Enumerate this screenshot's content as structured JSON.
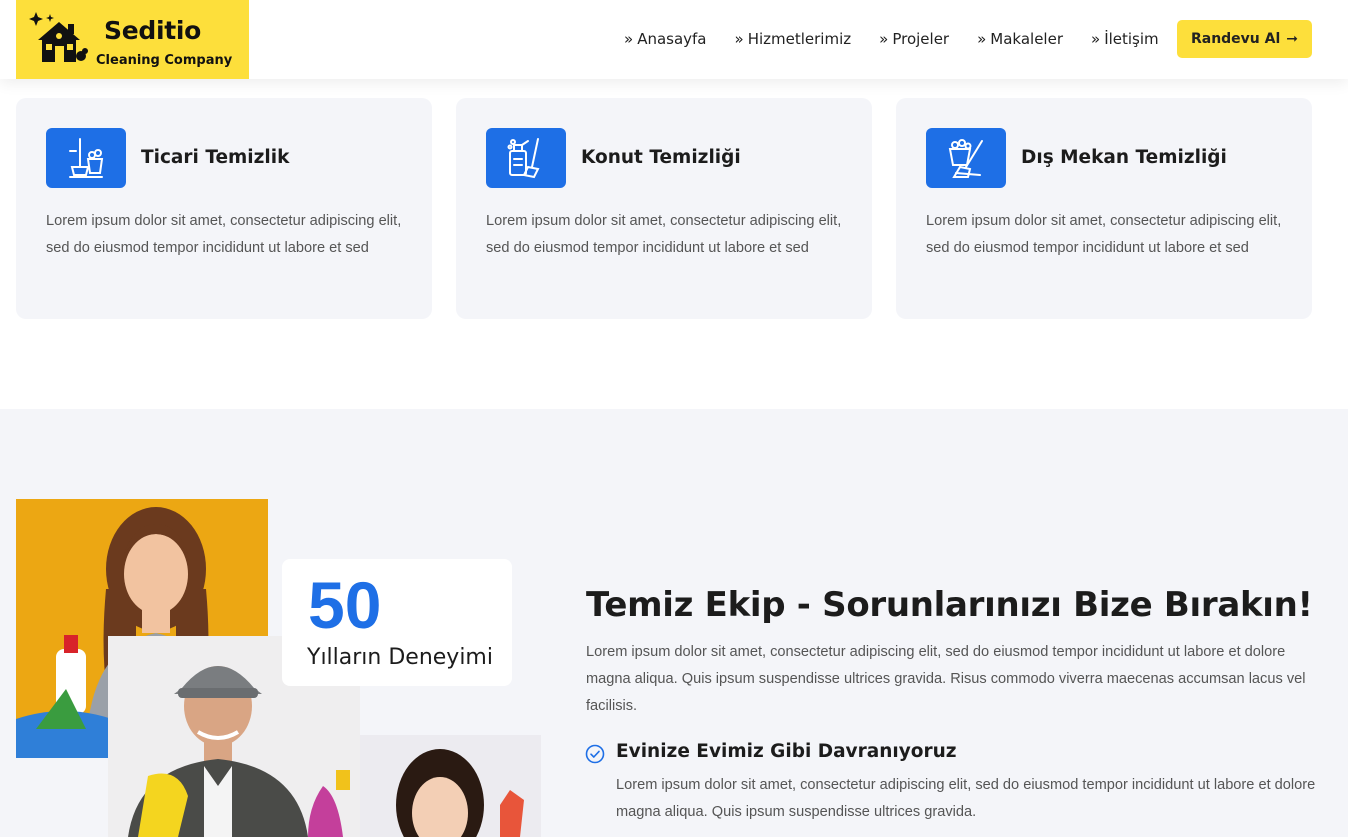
{
  "brand": {
    "name": "Seditio",
    "tagline": "Cleaning Company",
    "bg_color": "#fddf3b"
  },
  "nav": {
    "items": [
      {
        "prefix": "»",
        "label": "Anasayfa"
      },
      {
        "prefix": "»",
        "label": "Hizmetlerimiz"
      },
      {
        "prefix": "»",
        "label": "Projeler"
      },
      {
        "prefix": "»",
        "label": "Makaleler"
      },
      {
        "prefix": "»",
        "label": "İletişim"
      }
    ],
    "cta_label": "Randevu Al",
    "cta_arrow": "➞"
  },
  "services": [
    {
      "icon": "mop-bucket-icon",
      "title": "Ticari Temizlik",
      "text": "Lorem ipsum dolor sit amet, consectetur adipiscing elit, sed do eiusmod tempor incididunt ut labore et sed"
    },
    {
      "icon": "cleaning-spray-icon",
      "title": "Konut Temizliği",
      "text": "Lorem ipsum dolor sit amet, consectetur adipiscing elit, sed do eiusmod tempor incididunt ut labore et sed"
    },
    {
      "icon": "broom-bucket-icon",
      "title": "Dış Mekan Temizliği",
      "text": "Lorem ipsum dolor sit amet, consectetur adipiscing elit, sed do eiusmod tempor incididunt ut labore et sed"
    }
  ],
  "about": {
    "stat_number": "50",
    "stat_label": "Yılların Deneyimi",
    "title": "Temiz Ekip - Sorunlarınızı Bize Bırakın!",
    "text": "Lorem ipsum dolor sit amet, consectetur adipiscing elit, sed do eiusmod tempor incididunt ut labore et dolore magna aliqua. Quis ipsum suspendisse ultrices gravida. Risus commodo viverra maecenas accumsan lacus vel facilisis.",
    "feature": {
      "icon": "check-circle-icon",
      "title": "Evinize Evimiz Gibi Davranıyoruz",
      "text": "Lorem ipsum dolor sit amet, consectetur adipiscing elit, sed do eiusmod tempor incididunt ut labore et dolore magna aliqua. Quis ipsum suspendisse ultrices gravida."
    }
  },
  "colors": {
    "accent_blue": "#1e6fe6",
    "accent_yellow": "#fddf3b",
    "section_bg": "#f4f5f9"
  }
}
